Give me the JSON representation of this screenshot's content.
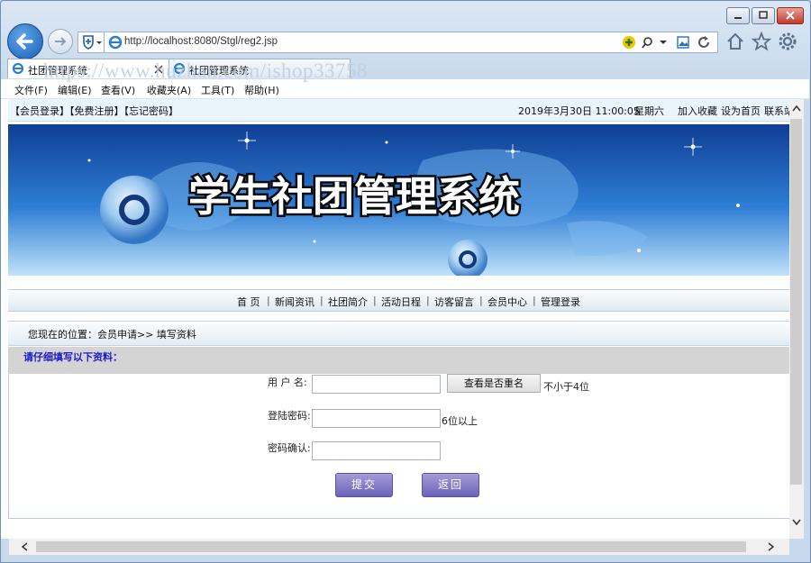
{
  "browser": {
    "url": "http://localhost:8080/Stgl/reg2.jsp",
    "tabs": [
      {
        "label": "社团管理系统"
      },
      {
        "label": "社团管理系统"
      }
    ],
    "menu": [
      "文件(F)",
      "编辑(E)",
      "查看(V)",
      "收藏夹(A)",
      "工具(T)",
      "帮助(H)"
    ],
    "watermark": "https://www.huzhan.com/ishop33758"
  },
  "page": {
    "top_links": "【会员登录】【免费注册】【忘记密码】",
    "datetime": "2019年3月30日 11:00:05",
    "weekday": "星期六",
    "right_links": [
      "加入收藏",
      "设为首页",
      "联系站"
    ],
    "banner_title": "学生社团管理系统",
    "nav": [
      "首 页",
      "新闻资讯",
      "社团简介",
      "活动日程",
      "访客留言",
      "会员中心",
      "管理登录"
    ],
    "nav_separator": "|",
    "location": "您现在的位置：会员申请>> 填写资料",
    "form_heading": "请仔细填写以下资料：",
    "form": {
      "username_label": "用 户 名:",
      "username_value": "",
      "check_button": "查看是否重名",
      "username_hint": "不小于4位",
      "password_label": "登陆密码:",
      "password_hint": "6位以上",
      "confirm_label": "密码确认:",
      "submit": "提交",
      "back": "返回"
    }
  },
  "colors": {
    "form_heading_text": "#1a1acc",
    "form_heading_bg": "#d4d4d4",
    "button_purple": "#7068bd",
    "banner_blue": "#1a5fb4"
  }
}
